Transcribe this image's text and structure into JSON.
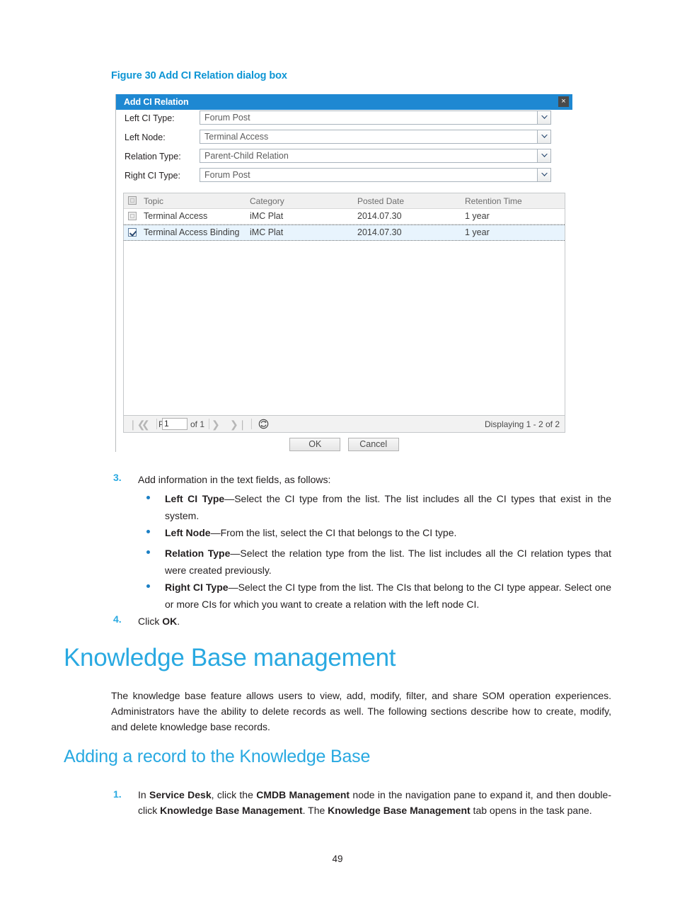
{
  "figure": {
    "caption": "Figure 30 Add CI Relation dialog box"
  },
  "dialog": {
    "title": "Add CI Relation",
    "close_label": "×",
    "fields": [
      {
        "label": "Left CI Type:",
        "value": "Forum Post"
      },
      {
        "label": "Left Node:",
        "value": "Terminal Access"
      },
      {
        "label": "Relation Type:",
        "value": "Parent-Child Relation"
      },
      {
        "label": "Right CI Type:",
        "value": "Forum Post"
      }
    ],
    "grid": {
      "columns": [
        "Topic",
        "Category",
        "Posted Date",
        "Retention Time"
      ],
      "rows": [
        {
          "checked": false,
          "selected": false,
          "topic": "Terminal Access",
          "category": "iMC Plat",
          "posted_date": "2014.07.30",
          "retention_time": "1 year"
        },
        {
          "checked": true,
          "selected": true,
          "topic": "Terminal Access Binding",
          "category": "iMC Plat",
          "posted_date": "2014.07.30",
          "retention_time": "1 year"
        }
      ]
    },
    "pager": {
      "first": "❘❮",
      "prev": "❮",
      "page_label": "Page",
      "page_value": "1",
      "of_label": "of 1",
      "next": "❯",
      "last": "❯❘",
      "refresh_icon": "refresh-icon",
      "display": "Displaying 1 - 2 of 2"
    },
    "buttons": {
      "ok": "OK",
      "cancel": "Cancel"
    }
  },
  "content": {
    "step3": {
      "number": "3.",
      "text": "Add information in the text fields, as follows:"
    },
    "bullets": [
      {
        "term": "Left CI Type",
        "body": "—Select the CI type from the list. The list includes all the CI types that exist in the system."
      },
      {
        "term": "Left Node",
        "body": "—From the list, select the CI that belongs to the CI type."
      },
      {
        "term": "Relation Type",
        "body": "—Select the relation type from the list. The list includes all the CI relation types that were created previously."
      },
      {
        "term": "Right CI Type",
        "body": "—Select the CI type from the list. The CIs that belong to the CI type appear. Select one or more CIs for which you want to create a relation with the left node CI."
      }
    ],
    "step4": {
      "number": "4.",
      "prefix": "Click ",
      "bold": "OK",
      "suffix": "."
    },
    "heading1": "Knowledge Base management",
    "paragraph1": "The knowledge base feature allows users to view, add, modify, filter, and share SOM operation experiences. Administrators have the ability to delete records as well. The following sections describe how to create, modify, and delete knowledge base records.",
    "heading2": "Adding a record to the Knowledge Base",
    "step1": {
      "number": "1.",
      "p1": "In ",
      "b1": "Service Desk",
      "p2": ", click the ",
      "b2": "CMDB Management",
      "p3": " node in the navigation pane to expand it, and then double-click ",
      "b3": "Knowledge Base Management",
      "p4": ". The ",
      "b4": "Knowledge Base Management",
      "p5": " tab opens in the task pane."
    },
    "page_number": "49"
  }
}
